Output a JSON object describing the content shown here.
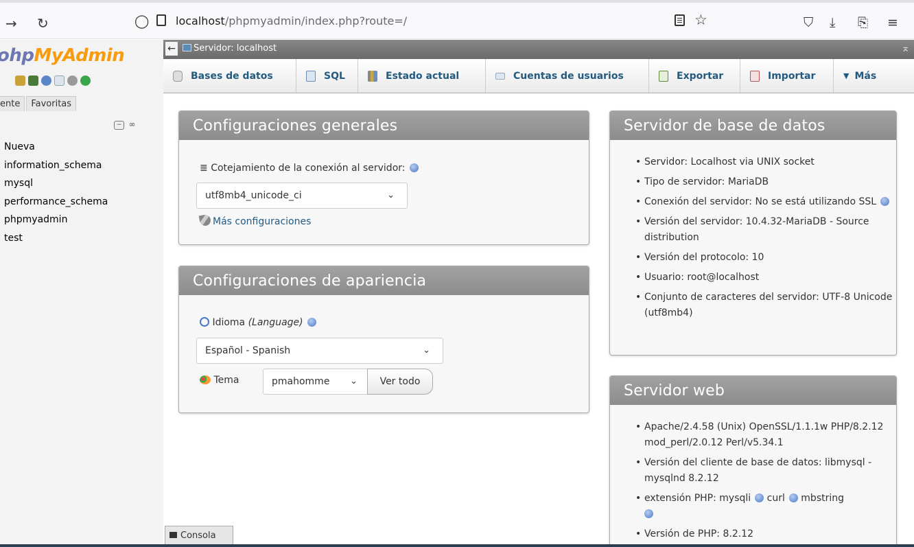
{
  "browser": {
    "url_host": "localhost",
    "url_path": "/phpmyadmin/index.php?route=/"
  },
  "sidebar": {
    "logo_part1": "ohp",
    "logo_part2": "MyAdmin",
    "tabs": [
      "ente",
      "Favoritas"
    ],
    "databases": [
      "Nueva",
      "information_schema",
      "mysql",
      "performance_schema",
      "phpmyadmin",
      "test"
    ]
  },
  "topbar": {
    "server": "Servidor: localhost"
  },
  "menu": {
    "tabs": [
      "Bases de datos",
      "SQL",
      "Estado actual",
      "Cuentas de usuarios",
      "Exportar",
      "Importar",
      "Más"
    ]
  },
  "general": {
    "title": "Configuraciones generales",
    "collation_label": "Cotejamiento de la conexión al servidor:",
    "collation_value": "utf8mb4_unicode_ci",
    "more_settings": "Más configuraciones"
  },
  "appearance": {
    "title": "Configuraciones de apariencia",
    "language_label": "Idioma",
    "language_label_en": "(Language)",
    "language_value": "Español - Spanish",
    "theme_label": "Tema",
    "theme_value": "pmahomme",
    "view_all": "Ver todo"
  },
  "db_server": {
    "title": "Servidor de base de datos",
    "items": [
      "Servidor: Localhost via UNIX socket",
      "Tipo de servidor: MariaDB",
      "Conexión del servidor: No se está utilizando SSL",
      "Versión del servidor: 10.4.32-MariaDB - Source distribution",
      "Versión del protocolo: 10",
      "Usuario: root@localhost",
      "Conjunto de caracteres del servidor: UTF-8 Unicode (utf8mb4)"
    ]
  },
  "web_server": {
    "title": "Servidor web",
    "items": [
      "Apache/2.4.58 (Unix) OpenSSL/1.1.1w PHP/8.2.12 mod_perl/2.0.12 Perl/v5.34.1",
      "Versión del cliente de base de datos: libmysql - mysqlnd 8.2.12",
      "extensión PHP: mysqli",
      "Versión de PHP: 8.2.12"
    ],
    "ext_curl": "curl",
    "ext_mbstring": "mbstring"
  },
  "console": {
    "label": "Consola"
  }
}
